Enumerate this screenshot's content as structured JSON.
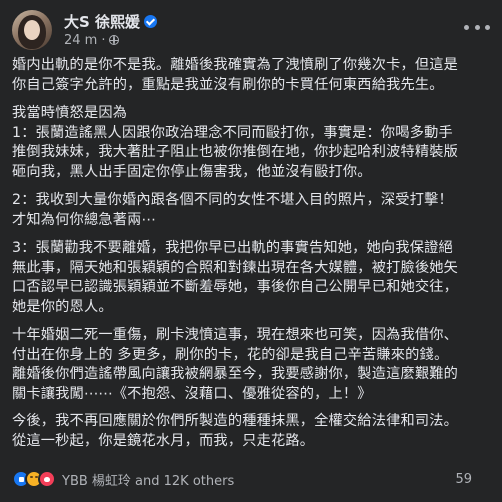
{
  "post": {
    "author": "大S 徐熙媛",
    "time": "24 m",
    "separator": "·",
    "audience_icon": "globe-icon",
    "more_icon": "more-icon",
    "content": {
      "p1": [
        "婚内出軌的是你不是我。離婚後我確實為了洩憤刷了你幾次卡，但這是",
        "你自己簽字允許的，重點是我並沒有刷你的卡買任何東西給我先生。"
      ],
      "p2": [
        "我當時憤怒是因為",
        "1：張蘭造謠黑人因跟你政治理念不同而毆打你，事實是：你喝多動手",
        "推倒我妹妹，我大著肚子阻止也被你推倒在地，你抄起哈利波特精裝版",
        "砸向我，黑人出手固定你停止傷害我，他並沒有毆打你。"
      ],
      "p3": [
        "2：我收到大量你婚內跟各個不同的女性不堪入目的照片，深受打擊！",
        "才知為何你總急著兩⋯"
      ],
      "p4": [
        "3：張蘭勸我不要離婚，我把你早已出軌的事實告知她，她向我保證絕",
        "無此事，隔天她和張穎穎的合照和對鍊出現在各大媒體，被打臉後她矢",
        "口否認早已認識張穎穎並不斷羞辱她，事後你自己公開早已和她交往，",
        "她是你的恩人。"
      ],
      "p5": [
        "十年婚姻二死一重傷，刷卡洩憤這事，現在想來也可笑，因為我借你、",
        "付出在你身上的 多更多，刷你的卡，花的卻是我自己辛苦賺來的錢。",
        "離婚後你們造謠帶風向讓我被網暴至今，我要感謝你，製造這麼艱難的",
        "關卡讓我闖⋯⋯《不抱怨、沒藉口、優雅從容的，上！》"
      ],
      "p6": [
        "今後，我不再回應關於你們所製造的種種抹黑，全權交給法律和司法。",
        "從這一秒起，你是鏡花水月，而我，只走花路。"
      ]
    },
    "reactions": {
      "icons": [
        "like-icon",
        "haha-icon",
        "love-icon"
      ],
      "summary": "YBB 楊虹玲 and 12K others"
    },
    "comment_count_partial": "59"
  },
  "colors": {
    "background": "#242526",
    "text_primary": "#e4e6eb",
    "text_secondary": "#b0b3b8",
    "verified": "#1877f2"
  }
}
